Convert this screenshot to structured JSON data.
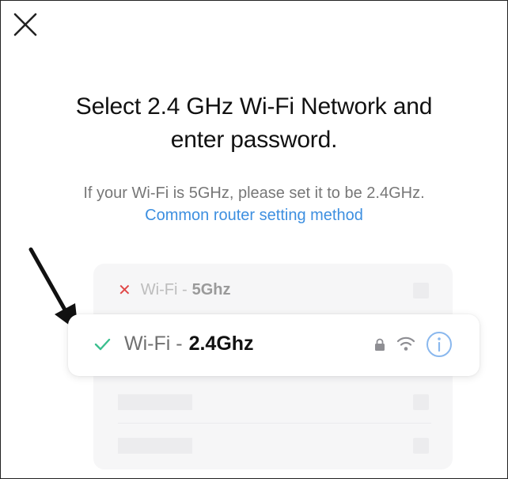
{
  "title": {
    "line1": "Select 2.4 GHz Wi-Fi Network and",
    "line2": "enter password."
  },
  "hint": "If your Wi-Fi is 5GHz, please set it to be 2.4GHz.",
  "link": "Common router setting method",
  "networks": [
    {
      "prefix": "Wi-Fi -",
      "band": "5Ghz",
      "status": "unsupported"
    },
    {
      "prefix": "Wi-Fi -",
      "band": "2.4Ghz",
      "status": "supported"
    }
  ],
  "icons": {
    "close": "close-icon",
    "arrow": "arrow-icon",
    "cross": "cross-icon",
    "check": "check-icon",
    "lock": "lock-icon",
    "wifi": "wifi-icon",
    "info": "info-icon"
  },
  "colors": {
    "link": "#3d8fe0",
    "check": "#3bbf8f",
    "cross": "#e04848",
    "info": "#8ab8ee"
  }
}
